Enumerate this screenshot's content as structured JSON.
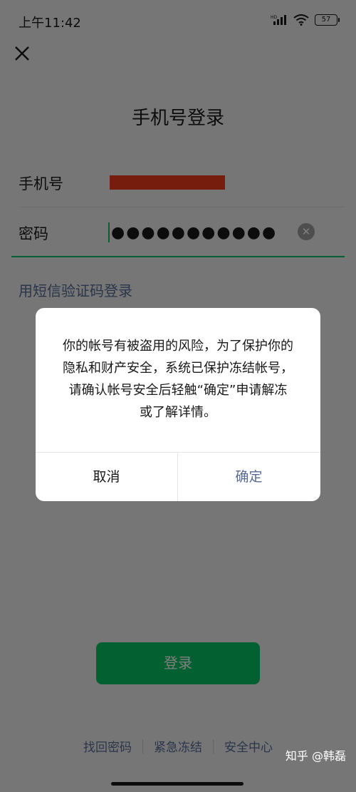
{
  "status_bar": {
    "time": "上午11:42",
    "signal": "HD",
    "battery": "57"
  },
  "page": {
    "title": "手机号登录",
    "phone_label": "手机号",
    "password_label": "密码",
    "password_mask": "●●●●●●●●●●●",
    "sms_login": "用短信验证码登录",
    "login_button": "登录"
  },
  "footer": {
    "links": [
      "找回密码",
      "紧急冻结",
      "安全中心"
    ]
  },
  "dialog": {
    "message": "你的帐号有被盗用的风险，为了保护你的隐私和财产安全，系统已保护冻结帐号，请确认帐号安全后轻触“确定”申请解冻或了解详情。",
    "cancel": "取消",
    "confirm": "确定"
  },
  "watermark": "知乎 @韩磊"
}
